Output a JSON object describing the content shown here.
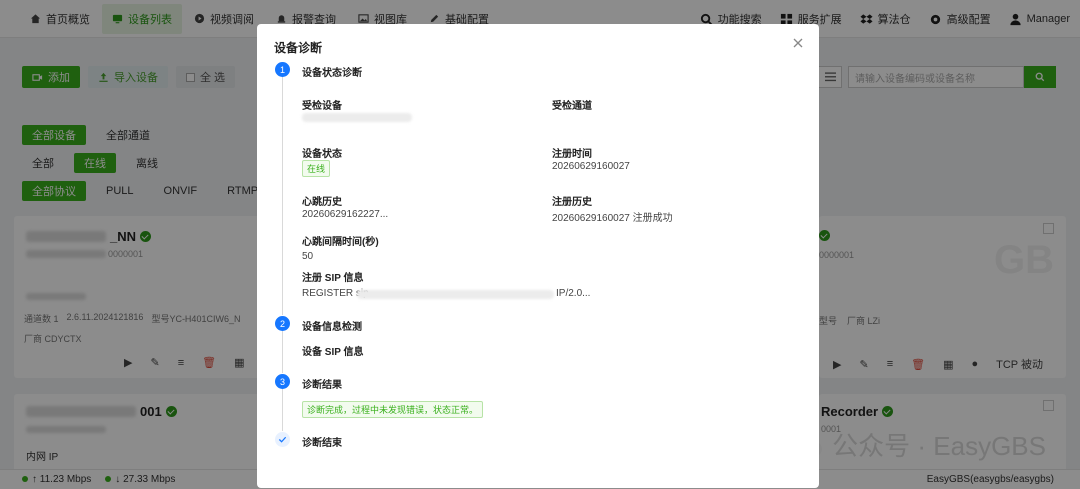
{
  "nav": {
    "items": [
      {
        "label": "首页概览"
      },
      {
        "label": "设备列表"
      },
      {
        "label": "视频调阅"
      },
      {
        "label": "报警查询"
      },
      {
        "label": "视图库"
      },
      {
        "label": "基础配置"
      }
    ],
    "right": [
      {
        "label": "功能搜索"
      },
      {
        "label": "服务扩展"
      },
      {
        "label": "算法仓"
      },
      {
        "label": "高级配置"
      },
      {
        "label": "Manager"
      }
    ]
  },
  "toolbar": {
    "add_label": "添加",
    "import_label": "导入设备",
    "select_all_label": "全 选"
  },
  "search": {
    "placeholder": "请输入设备编码或设备名称"
  },
  "filters": {
    "scope": [
      "全部设备",
      "全部通道"
    ],
    "status": [
      "全部",
      "在线",
      "离线"
    ],
    "protocol": [
      "全部协议",
      "PULL",
      "ONVIF",
      "RTMP"
    ]
  },
  "cards": {
    "c1_title_suffix": "_NN",
    "c1_code_suffix": "0000001",
    "c1_channels": "通道数 1",
    "c1_version": "2.6.11.2024121816",
    "c1_model": "型号YC-H401CIW6_N",
    "c1_vendor": "厂商 CDYCTX",
    "c2_code_suffix": "0000001",
    "c2_model": "型号",
    "c2_vendor": "厂商 LZi",
    "c2_tcp": "TCP 被动",
    "c3_title_suffix": "001",
    "c3_ip_label": "内网 IP",
    "c4_title": "Recorder",
    "c4_code_suffix": "0001",
    "badge": "GB"
  },
  "statusbar": {
    "up": "11.23 Mbps",
    "down": "27.33 Mbps",
    "server": "EasyGBS(easygbs/easygbs)"
  },
  "modal": {
    "title": "设备诊断",
    "steps": [
      {
        "num": "1",
        "title": "设备状态诊断"
      },
      {
        "num": "2",
        "title": "设备信息检测"
      },
      {
        "num": "3",
        "title": "诊断结果"
      },
      {
        "title": "诊断结束"
      }
    ],
    "fields": {
      "device_label": "受检设备",
      "channel_label": "受检通道",
      "status_label": "设备状态",
      "status_value": "在线",
      "reg_time_label": "注册时间",
      "reg_time_value": "20260629160027",
      "heartbeat_label": "心跳历史",
      "heartbeat_value": "20260629162227...",
      "reg_history_label": "注册历史",
      "reg_history_value": "20260629160027 注册成功",
      "interval_label": "心跳间隔时间(秒)",
      "interval_value": "50",
      "sip_label": "注册 SIP 信息",
      "sip_value_prefix": "REGISTER sip",
      "sip_value_suffix": "IP/2.0...",
      "device_sip_label": "设备 SIP 信息",
      "result_tag": "诊断完成，过程中未发现错误，状态正常。"
    }
  },
  "watermark": {
    "text": "公众号 · EasyGBS"
  }
}
